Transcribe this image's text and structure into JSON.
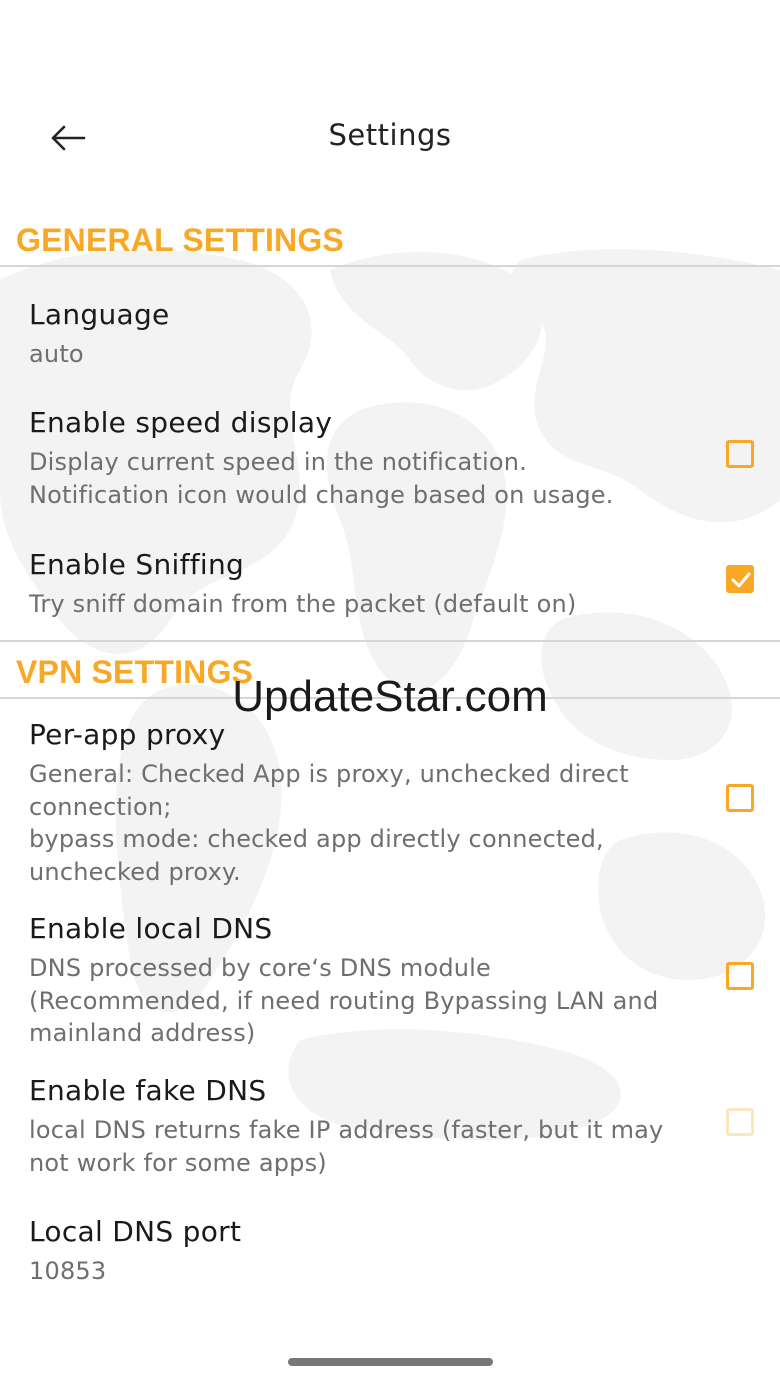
{
  "app_bar": {
    "title": "Settings",
    "back_icon": "arrow-left-icon"
  },
  "sections": {
    "general": {
      "header": "GENERAL SETTINGS",
      "items": {
        "language": {
          "title": "Language",
          "summary": "auto"
        },
        "speed_display": {
          "title": "Enable speed display",
          "summary": "Display current speed in the notification.\nNotification icon would change based on usage.",
          "checked": false
        },
        "sniffing": {
          "title": "Enable Sniffing",
          "summary": "Try sniff domain from the packet (default on)",
          "checked": true
        }
      }
    },
    "vpn": {
      "header": "VPN SETTINGS",
      "items": {
        "per_app_proxy": {
          "title": "Per-app proxy",
          "summary": "General: Checked App is proxy, unchecked direct connection;\nbypass mode: checked app directly connected, unchecked proxy.",
          "checked": false
        },
        "local_dns": {
          "title": "Enable local DNS",
          "summary": "DNS processed by core‘s DNS module (Recommended, if need routing Bypassing LAN and mainland address)",
          "checked": false
        },
        "fake_dns": {
          "title": "Enable fake DNS",
          "summary": "local DNS returns fake IP address (faster, but it may not work for some apps)",
          "checked": false,
          "enabled": false
        },
        "local_dns_port": {
          "title": "Local DNS port",
          "summary": "10853"
        }
      }
    }
  },
  "watermark": "UpdateStar.com",
  "colors": {
    "accent": "#f9a825",
    "accent_disabled": "#fbe6c0",
    "title_text": "#1a1a1a",
    "summary_text": "#6f6f6f",
    "divider": "#d6d6d6"
  }
}
